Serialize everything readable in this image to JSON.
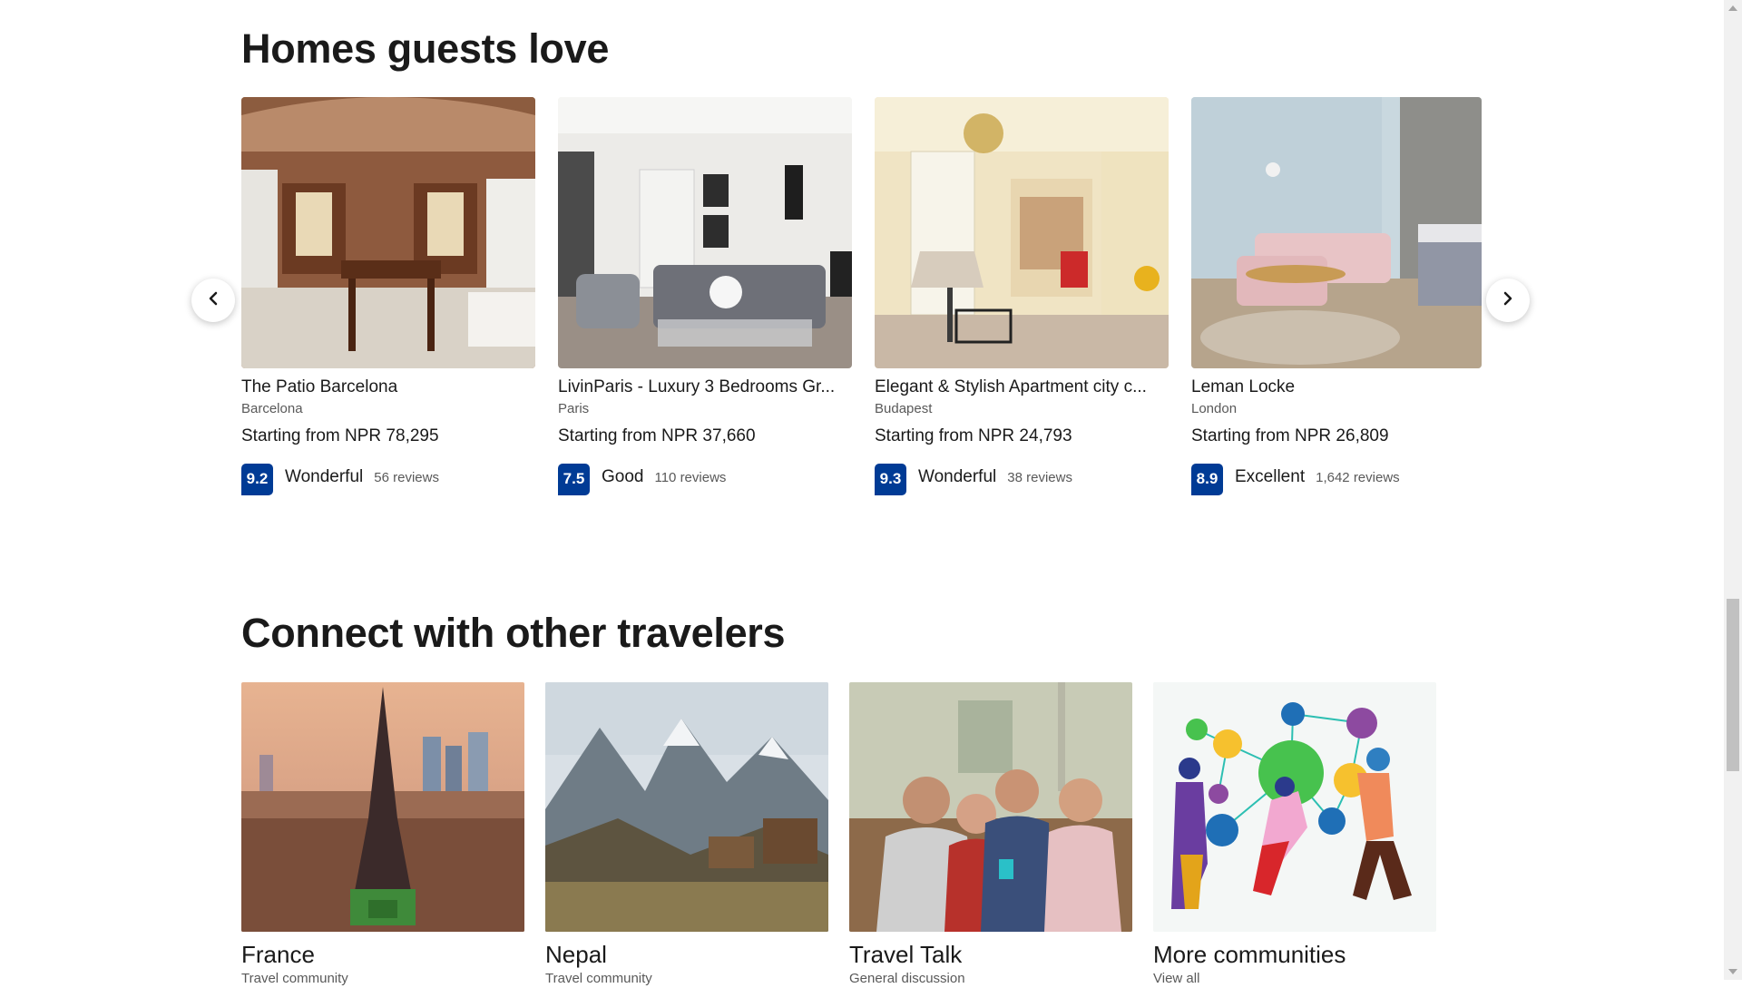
{
  "homes_section": {
    "title": "Homes guests love",
    "cards": [
      {
        "name": "The Patio Barcelona",
        "city": "Barcelona",
        "price": "Starting from NPR 78,295",
        "score": "9.2",
        "word": "Wonderful",
        "reviews": "56 reviews"
      },
      {
        "name": "LivinParis - Luxury 3 Bedrooms Gr...",
        "city": "Paris",
        "price": "Starting from NPR 37,660",
        "score": "7.5",
        "word": "Good",
        "reviews": "110 reviews"
      },
      {
        "name": "Elegant & Stylish Apartment city c...",
        "city": "Budapest",
        "price": "Starting from NPR 24,793",
        "score": "9.3",
        "word": "Wonderful",
        "reviews": "38 reviews"
      },
      {
        "name": "Leman Locke",
        "city": "London",
        "price": "Starting from NPR 26,809",
        "score": "8.9",
        "word": "Excellent",
        "reviews": "1,642 reviews"
      }
    ]
  },
  "connect_section": {
    "title": "Connect with other travelers",
    "cards": [
      {
        "name": "France",
        "subtitle": "Travel community"
      },
      {
        "name": "Nepal",
        "subtitle": "Travel community"
      },
      {
        "name": "Travel Talk",
        "subtitle": "General discussion"
      },
      {
        "name": "More communities",
        "subtitle": "View all"
      }
    ]
  },
  "colors": {
    "score_badge": "#003b95",
    "title_text": "#1a1a1a",
    "secondary_text": "#595959"
  },
  "icons": {
    "carousel_prev": "chevron-left-icon",
    "carousel_next": "chevron-right-icon"
  }
}
